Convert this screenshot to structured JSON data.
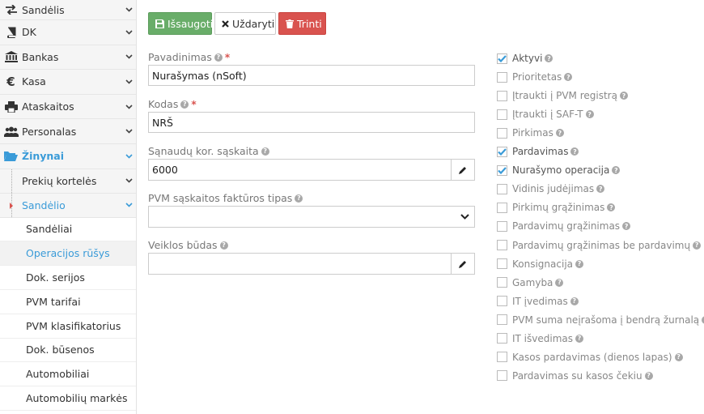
{
  "sidebar": {
    "items": [
      {
        "label": "Sandėlis",
        "icon": "exchange-icon"
      },
      {
        "label": "DK",
        "icon": "book-icon"
      },
      {
        "label": "Bankas",
        "icon": "bank-icon"
      },
      {
        "label": "Kasa",
        "icon": "euro-icon"
      },
      {
        "label": "Ataskaitos",
        "icon": "print-icon"
      },
      {
        "label": "Personalas",
        "icon": "users-icon"
      },
      {
        "label": "Žinynai",
        "icon": "folder-open-icon"
      }
    ],
    "sub_items": [
      {
        "label": "Prekių kortelės"
      },
      {
        "label": "Sandėlio"
      }
    ],
    "leaves": [
      {
        "label": "Sandėliai"
      },
      {
        "label": "Operacijos rūšys"
      },
      {
        "label": "Dok. serijos"
      },
      {
        "label": "PVM tarifai"
      },
      {
        "label": "PVM klasifikatorius"
      },
      {
        "label": "Dok. būsenos"
      },
      {
        "label": "Automobiliai"
      },
      {
        "label": "Automobilių markės"
      }
    ],
    "colors": {
      "accent": "#3a9bd8",
      "marker": "#d9534f"
    }
  },
  "toolbar": {
    "save_label": "Išsaugoti",
    "close_label": "Uždaryti",
    "delete_label": "Trinti",
    "colors": {
      "save": "#69ad69",
      "delete": "#d9534f"
    }
  },
  "form": {
    "name_label": "Pavadinimas",
    "name_value": "Nurašymas (nSoft)",
    "code_label": "Kodas",
    "code_value": "NRŠ",
    "cost_account_label": "Sąnaudų kor. sąskaita",
    "cost_account_value": "6000",
    "vat_invoice_type_label": "PVM sąskaitos faktūros tipas",
    "vat_invoice_type_value": "",
    "activity_type_label": "Veiklos būdas",
    "activity_type_value": ""
  },
  "flags": [
    {
      "label": "Aktyvi",
      "checked": true
    },
    {
      "label": "Prioritetas",
      "checked": false
    },
    {
      "label": "Įtraukti į PVM registrą",
      "checked": false
    },
    {
      "label": "Įtraukti į SAF-T",
      "checked": false
    },
    {
      "label": "Pirkimas",
      "checked": false
    },
    {
      "label": "Pardavimas",
      "checked": true
    },
    {
      "label": "Nurašymo operacija",
      "checked": true
    },
    {
      "label": "Vidinis judėjimas",
      "checked": false
    },
    {
      "label": "Pirkimų grąžinimas",
      "checked": false
    },
    {
      "label": "Pardavimų grąžinimas",
      "checked": false
    },
    {
      "label": "Pardavimų grąžinimas be pardavimų",
      "checked": false
    },
    {
      "label": "Konsignacija",
      "checked": false
    },
    {
      "label": "Gamyba",
      "checked": false
    },
    {
      "label": "IT įvedimas",
      "checked": false
    },
    {
      "label": "PVM suma neįrašoma į bendrą žurnalą",
      "checked": false
    },
    {
      "label": "IT išvedimas",
      "checked": false
    },
    {
      "label": "Kasos pardavimas (dienos lapas)",
      "checked": false
    },
    {
      "label": "Pardavimas su kasos čekiu",
      "checked": false
    }
  ]
}
